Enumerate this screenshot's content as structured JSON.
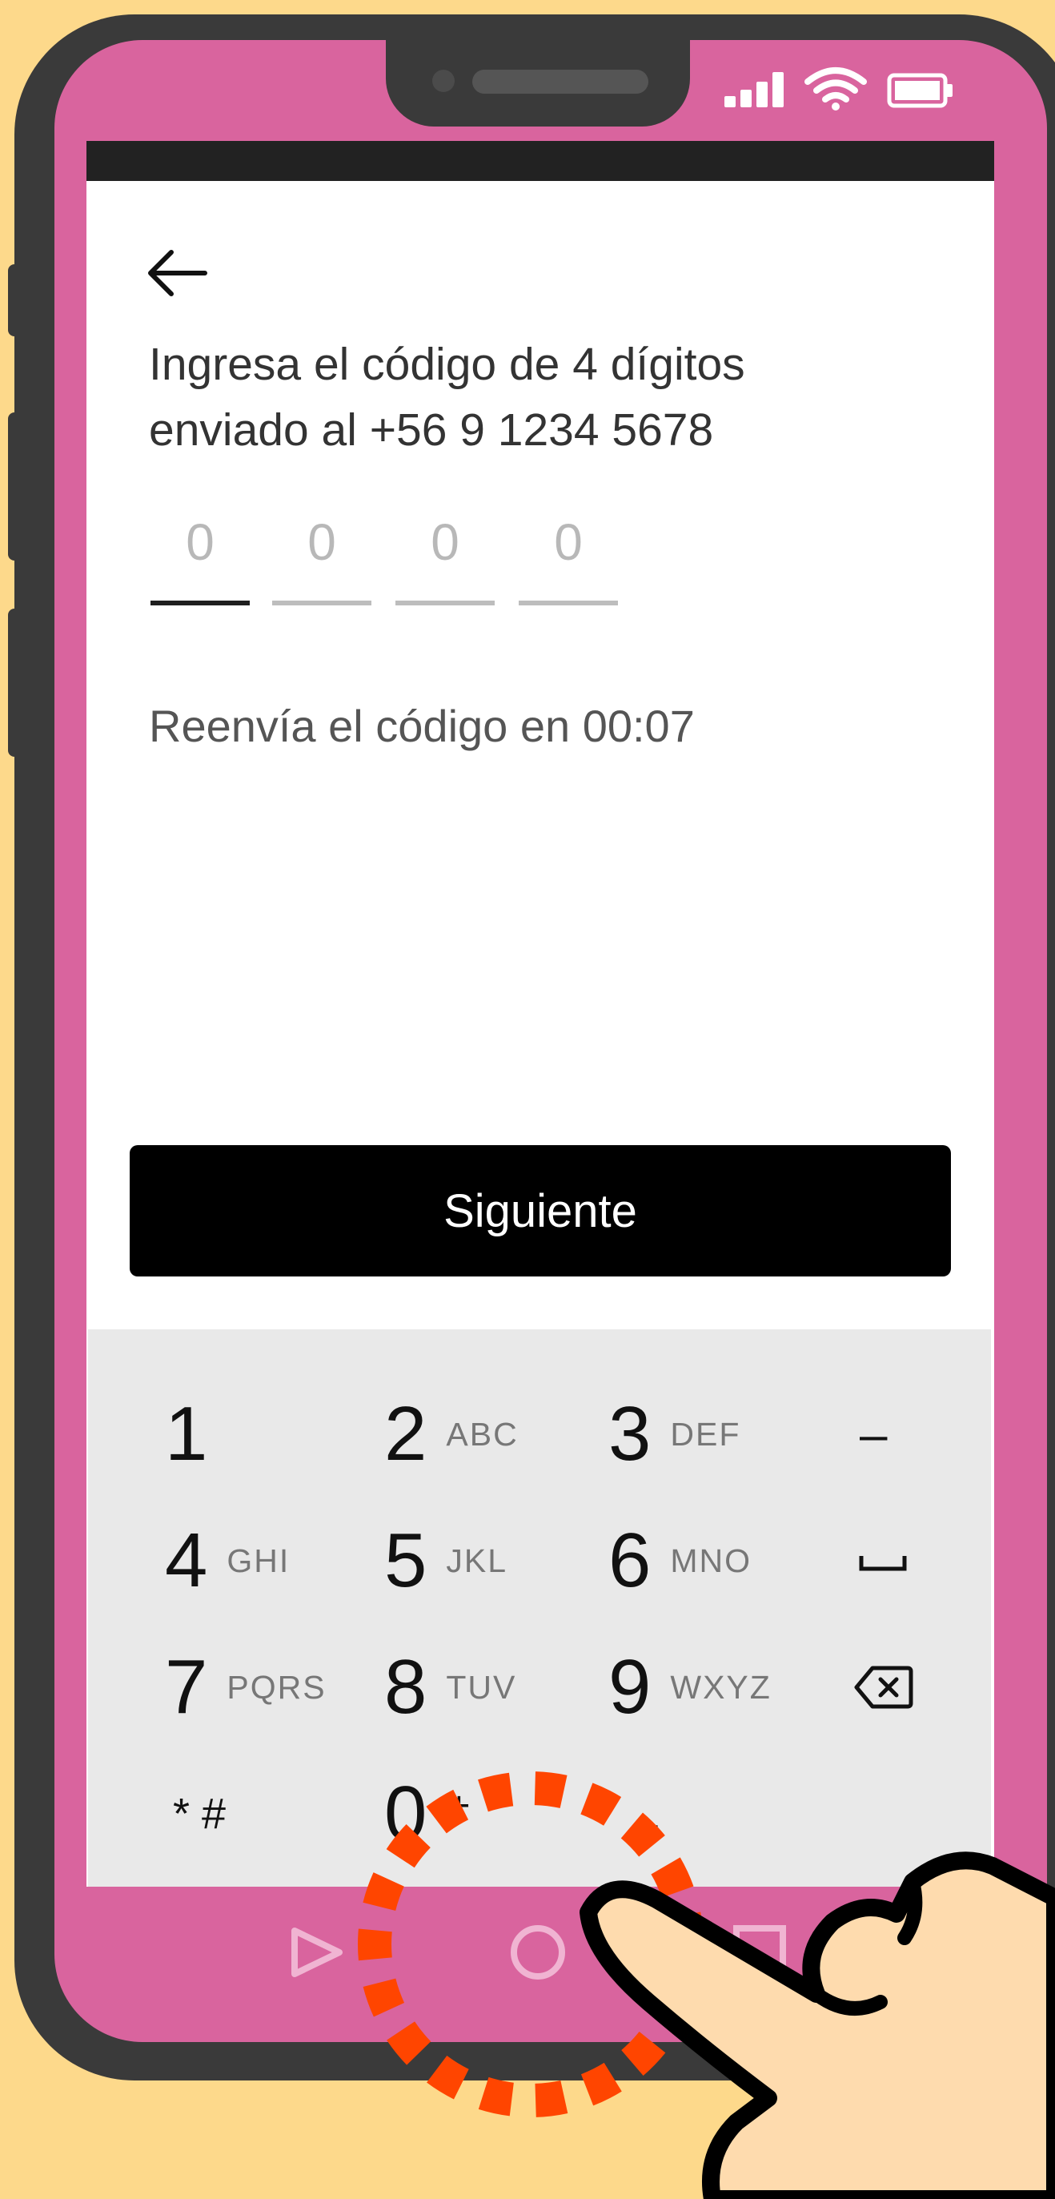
{
  "phone": {
    "status_icons": [
      "signal-icon",
      "wifi-icon",
      "battery-icon"
    ]
  },
  "screen": {
    "back_icon": "arrow-left-icon",
    "prompt_line1": "Ingresa el código de 4 dígitos",
    "prompt_line2": "enviado al  +56 9 1234 5678",
    "code_slots": [
      "0",
      "0",
      "0",
      "0"
    ],
    "resend_text": "Reenvía el código en 00:07",
    "next_label": "Siguiente"
  },
  "keypad": {
    "rows": [
      [
        {
          "num": "1",
          "letters": ""
        },
        {
          "num": "2",
          "letters": "ABC"
        },
        {
          "num": "3",
          "letters": "DEF"
        },
        {
          "sym": "–"
        }
      ],
      [
        {
          "num": "4",
          "letters": "GHI"
        },
        {
          "num": "5",
          "letters": "JKL"
        },
        {
          "num": "6",
          "letters": "MNO"
        },
        {
          "icon": "space-icon"
        }
      ],
      [
        {
          "num": "7",
          "letters": "PQRS"
        },
        {
          "num": "8",
          "letters": "TUV"
        },
        {
          "num": "9",
          "letters": "WXYZ"
        },
        {
          "icon": "backspace-icon"
        }
      ],
      [
        {
          "sym": "* #"
        },
        {
          "num": "0",
          "letters": "+"
        },
        {
          "sym": "."
        },
        {
          "icon": "next-field-icon"
        }
      ]
    ],
    "accent_color": "#1f78e4"
  },
  "nav": {
    "buttons": [
      "nav-back-icon",
      "nav-home-icon",
      "nav-recents-icon"
    ]
  },
  "colors": {
    "background": "#fdd98b",
    "phone_pink": "#d9649e",
    "tap_indicator": "#ff4500"
  }
}
